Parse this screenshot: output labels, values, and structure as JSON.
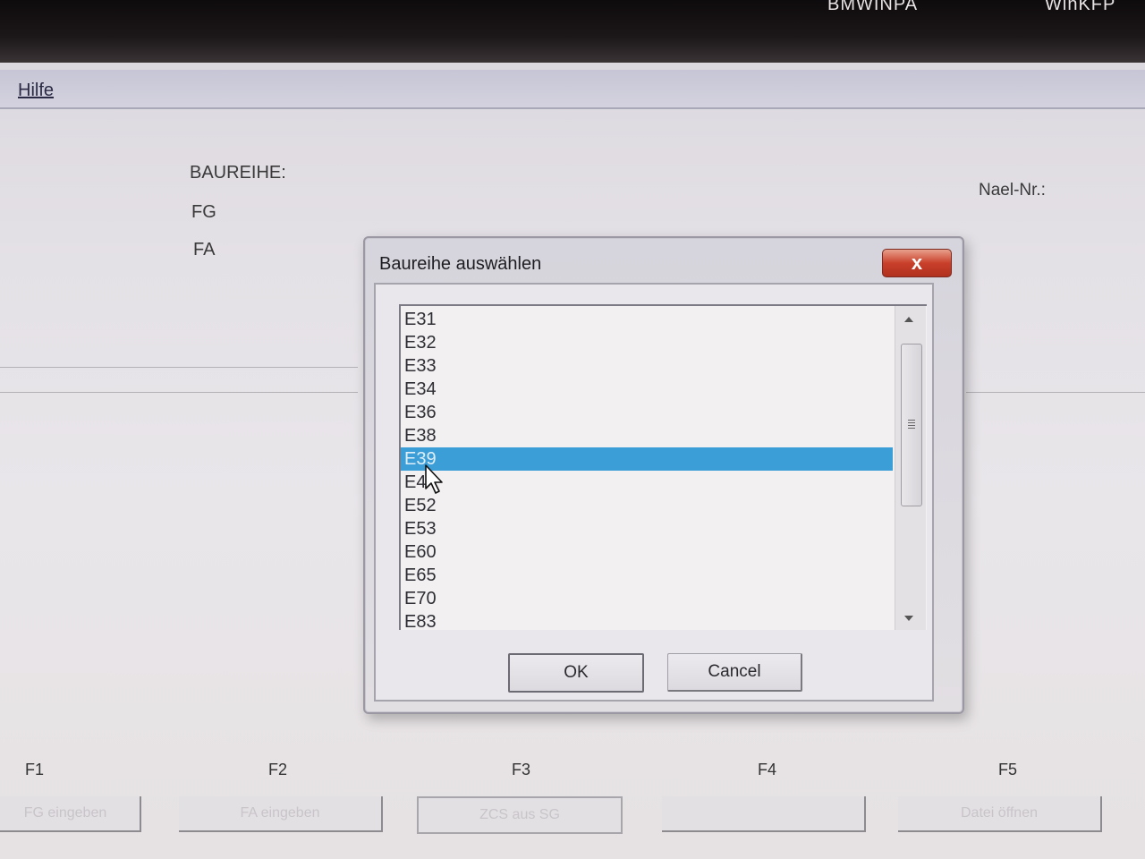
{
  "desktop": {
    "shortcuts": [
      "BMWINPA",
      "WinKFP"
    ]
  },
  "app": {
    "menu": {
      "help": "Hilfe"
    },
    "fields": {
      "baureihe_label": "BAUREIHE:",
      "fg_label": "FG",
      "fa_label": "FA",
      "nael_label": "Nael-Nr.:"
    },
    "function_keys": [
      {
        "key": "F1",
        "label": "FG eingeben"
      },
      {
        "key": "F2",
        "label": "FA eingeben"
      },
      {
        "key": "F3",
        "label": "ZCS aus SG"
      },
      {
        "key": "F4",
        "label": ""
      },
      {
        "key": "F5",
        "label": "Datei öffnen"
      }
    ]
  },
  "dialog": {
    "title": "Baureihe auswählen",
    "close_label": "x",
    "items": [
      "E31",
      "E32",
      "E33",
      "E34",
      "E36",
      "E38",
      "E39",
      "E4",
      "E52",
      "E53",
      "E60",
      "E65",
      "E70",
      "E83"
    ],
    "selected_index": 6,
    "ok_label": "OK",
    "cancel_label": "Cancel"
  },
  "colors": {
    "selection": "#3c9ed6",
    "close_button": "#c9402a",
    "menubar": "#c6c6d6"
  }
}
